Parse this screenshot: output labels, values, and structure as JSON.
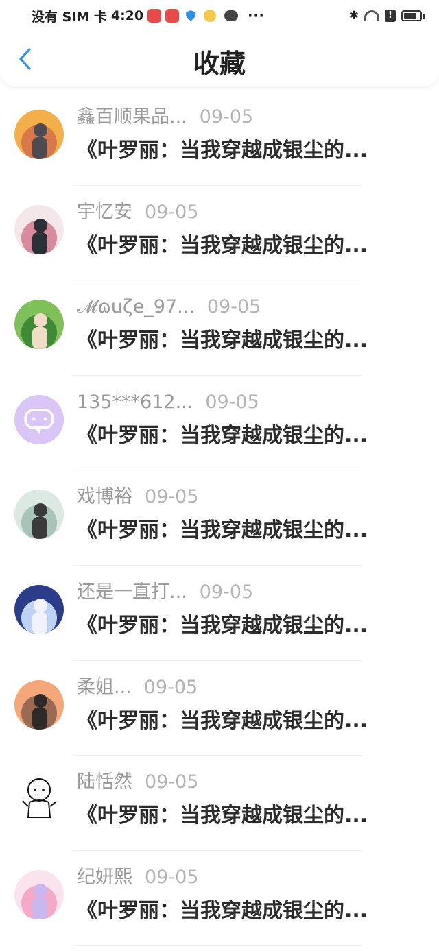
{
  "status_bar": {
    "carrier": "没有 SIM 卡",
    "time": "4:20",
    "more": "···"
  },
  "header": {
    "title": "收藏"
  },
  "favorites": [
    {
      "username": "鑫百顺果品...",
      "date": "09-05",
      "title": "《叶罗丽：当我穿越成银尘的...",
      "avatar": {
        "icon": "sunset-photo-avatar",
        "colors": [
          "#f3b04a",
          "#d9784a",
          "#4e4a52"
        ]
      }
    },
    {
      "username": "宇忆安",
      "date": "09-05",
      "title": "《叶罗丽：当我穿越成银尘的...",
      "avatar": {
        "icon": "girl-photo-avatar",
        "colors": [
          "#f4e7ea",
          "#d98a9c",
          "#2a3038"
        ]
      }
    },
    {
      "username": "𝓜ɷuζe_97...",
      "date": "09-05",
      "title": "《叶罗丽：当我穿越成银尘的...",
      "avatar": {
        "icon": "green-photo-avatar",
        "colors": [
          "#7fc05a",
          "#3f8a36",
          "#f1dcc8"
        ]
      }
    },
    {
      "username": "135***612...",
      "date": "09-05",
      "title": "《叶罗丽：当我穿越成银尘的...",
      "avatar": {
        "icon": "chat-bubble-avatar",
        "colors": [
          "#d9c6f7",
          "#ffffff",
          "#b9a3ea"
        ]
      }
    },
    {
      "username": "戏博裕",
      "date": "09-05",
      "title": "《叶罗丽：当我穿越成银尘的...",
      "avatar": {
        "icon": "girl-white-dress-avatar",
        "colors": [
          "#dbe9e2",
          "#a8c3b8",
          "#3a3a3a"
        ]
      }
    },
    {
      "username": "还是一直打...",
      "date": "09-05",
      "title": "《叶罗丽：当我穿越成银尘的...",
      "avatar": {
        "icon": "anime-girl-avatar",
        "colors": [
          "#2b3d8a",
          "#bcd3f5",
          "#f2f2fa"
        ]
      }
    },
    {
      "username": "柔姐...",
      "date": "09-05",
      "title": "《叶罗丽：当我穿越成银尘的...",
      "avatar": {
        "icon": "sunset-field-avatar",
        "colors": [
          "#f6a77a",
          "#9a6a52",
          "#2e2a2a"
        ]
      }
    },
    {
      "username": "陆恬然",
      "date": "09-05",
      "title": "《叶罗丽：当我穿越成银尘的...",
      "avatar": {
        "icon": "sketch-figure-avatar",
        "colors": [
          "#ffffff",
          "#111111",
          "#cccccc"
        ]
      }
    },
    {
      "username": "纪妍熙",
      "date": "09-05",
      "title": "《叶罗丽：当我穿越成银尘的...",
      "avatar": {
        "icon": "pink-anime-avatar",
        "colors": [
          "#fbe3ee",
          "#f4a9c7",
          "#c9b7f0"
        ]
      }
    }
  ]
}
